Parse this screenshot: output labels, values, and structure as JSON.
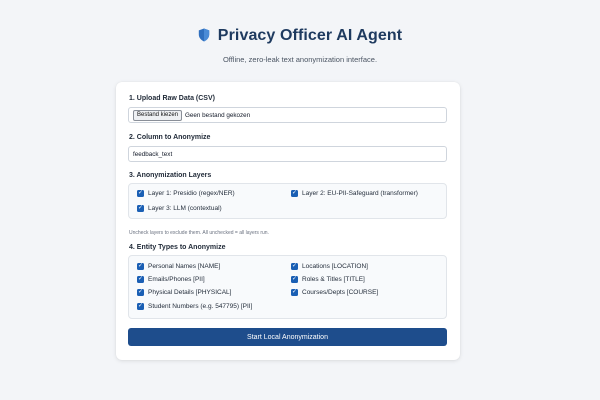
{
  "header": {
    "title": "Privacy Officer AI Agent",
    "subtitle": "Offline, zero-leak text anonymization interface.",
    "icon": "shield-icon"
  },
  "upload": {
    "label": "1. Upload Raw Data (CSV)",
    "button_label": "Bestand kiezen",
    "file_status": "Geen bestand gekozen"
  },
  "column": {
    "label": "2. Column to Anonymize",
    "value": "feedback_text"
  },
  "layers": {
    "label": "3. Anonymization Layers",
    "items": [
      {
        "label": "Layer 1: Presidio (regex/NER)",
        "checked": true
      },
      {
        "label": "Layer 2: EU-PII-Safeguard (transformer)",
        "checked": true
      },
      {
        "label": "Layer 3: LLM (contextual)",
        "checked": true
      }
    ],
    "note": "Uncheck layers to exclude them. All unchecked = all layers run."
  },
  "entities": {
    "label": "4. Entity Types to Anonymize",
    "items": [
      {
        "label": "Personal Names [NAME]",
        "checked": true
      },
      {
        "label": "Locations [LOCATION]",
        "checked": true
      },
      {
        "label": "Emails/Phones [PII]",
        "checked": true
      },
      {
        "label": "Roles & Titles [TITLE]",
        "checked": true
      },
      {
        "label": "Physical Details [PHYSICAL]",
        "checked": true
      },
      {
        "label": "Courses/Depts [COURSE]",
        "checked": true
      },
      {
        "label": "Student Numbers (e.g. 547795) [PII]",
        "checked": true
      }
    ]
  },
  "actions": {
    "start_label": "Start Local Anonymization"
  },
  "colors": {
    "accent": "#1e4d8c",
    "checkbox": "#1a5fb4",
    "title": "#1e3a5f",
    "background": "#f3f5f8"
  }
}
